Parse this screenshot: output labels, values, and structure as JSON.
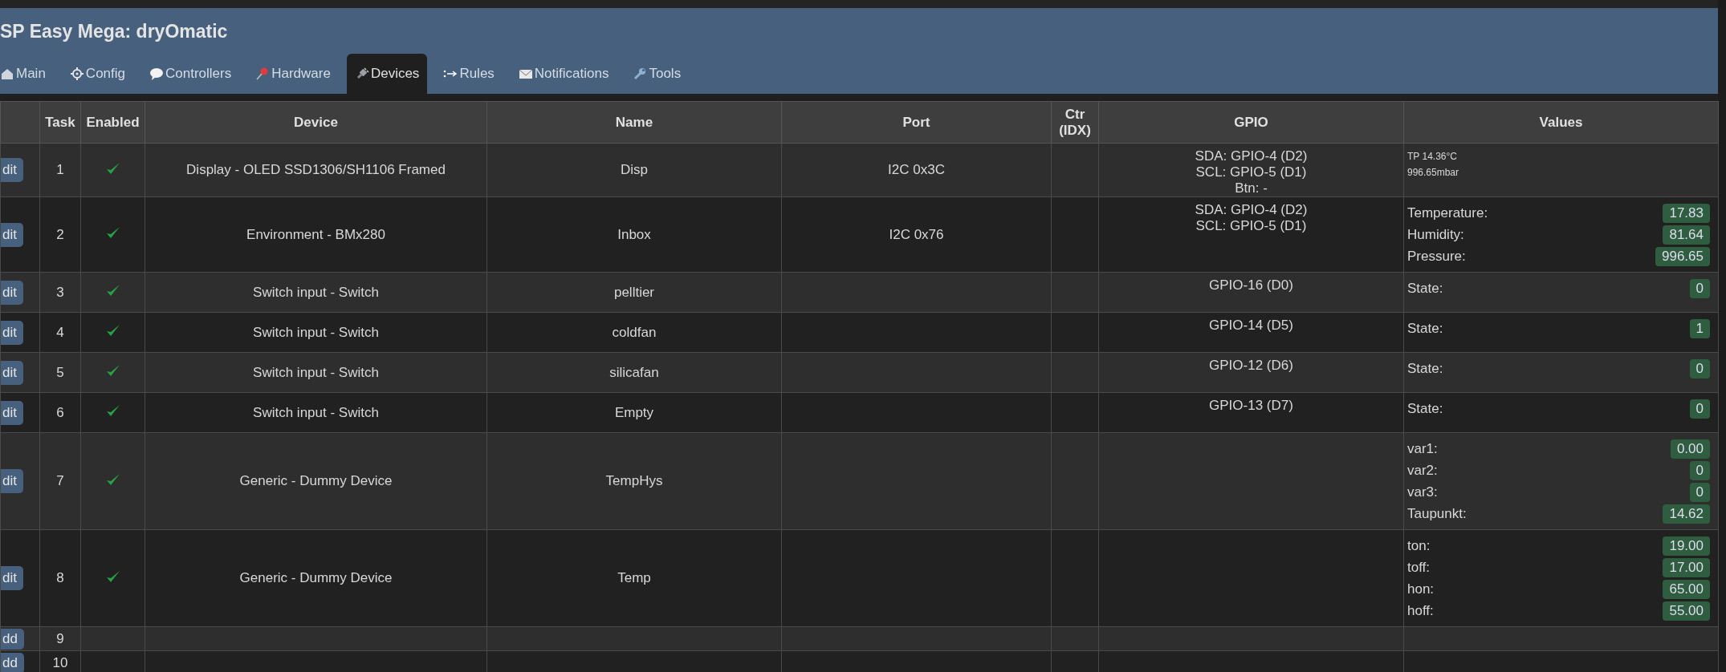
{
  "header": {
    "title": "SP Easy Mega: dryOmatic"
  },
  "tabs": [
    {
      "label": "Main",
      "selected": false
    },
    {
      "label": "Config",
      "selected": false
    },
    {
      "label": "Controllers",
      "selected": false
    },
    {
      "label": "Hardware",
      "selected": false
    },
    {
      "label": "Devices",
      "selected": true
    },
    {
      "label": "Rules",
      "selected": false
    },
    {
      "label": "Notifications",
      "selected": false
    },
    {
      "label": "Tools",
      "selected": false
    }
  ],
  "table": {
    "columns": [
      "",
      "Task",
      "Enabled",
      "Device",
      "Name",
      "Port",
      "Ctr (IDX)",
      "GPIO",
      "Values"
    ],
    "rows": [
      {
        "kind": "edit",
        "action": "dit",
        "task": "1",
        "enabled": true,
        "device": "Display - OLED SSD1306/SH1106 Framed",
        "name": "Disp",
        "port": "I2C 0x3C",
        "gpio": [
          "SDA: GPIO-4 (D2)",
          "SCL: GPIO-5 (D1)",
          "Btn: -"
        ],
        "values_text": [
          "TP 14.36°C",
          "996.65mbar"
        ]
      },
      {
        "kind": "edit",
        "action": "dit",
        "task": "2",
        "enabled": true,
        "device": "Environment - BMx280",
        "name": "Inbox",
        "port": "I2C 0x76",
        "gpio": [
          "SDA: GPIO-4 (D2)",
          "SCL: GPIO-5 (D1)"
        ],
        "values": [
          {
            "label": "Temperature:",
            "value": "17.83"
          },
          {
            "label": "Humidity:",
            "value": "81.64"
          },
          {
            "label": "Pressure:",
            "value": "996.65"
          }
        ]
      },
      {
        "kind": "edit",
        "action": "dit",
        "task": "3",
        "enabled": true,
        "device": "Switch input - Switch",
        "name": "pelltier",
        "gpio": [
          "GPIO-16 (D0)"
        ],
        "values": [
          {
            "label": "State:",
            "value": "0"
          }
        ]
      },
      {
        "kind": "edit",
        "action": "dit",
        "task": "4",
        "enabled": true,
        "device": "Switch input - Switch",
        "name": "coldfan",
        "gpio": [
          "GPIO-14 (D5)"
        ],
        "values": [
          {
            "label": "State:",
            "value": "1"
          }
        ]
      },
      {
        "kind": "edit",
        "action": "dit",
        "task": "5",
        "enabled": true,
        "device": "Switch input - Switch",
        "name": "silicafan",
        "gpio": [
          "GPIO-12 (D6)"
        ],
        "values": [
          {
            "label": "State:",
            "value": "0"
          }
        ]
      },
      {
        "kind": "edit",
        "action": "dit",
        "task": "6",
        "enabled": true,
        "device": "Switch input - Switch",
        "name": "Empty",
        "gpio": [
          "GPIO-13 (D7)"
        ],
        "values": [
          {
            "label": "State:",
            "value": "0"
          }
        ]
      },
      {
        "kind": "edit",
        "action": "dit",
        "task": "7",
        "enabled": true,
        "device": "Generic - Dummy Device",
        "name": "TempHys",
        "values": [
          {
            "label": "var1:",
            "value": "0.00"
          },
          {
            "label": "var2:",
            "value": "0"
          },
          {
            "label": "var3:",
            "value": "0"
          },
          {
            "label": "Taupunkt:",
            "value": "14.62"
          }
        ]
      },
      {
        "kind": "edit",
        "action": "dit",
        "task": "8",
        "enabled": true,
        "device": "Generic - Dummy Device",
        "name": "Temp",
        "values": [
          {
            "label": "ton:",
            "value": "19.00"
          },
          {
            "label": "toff:",
            "value": "17.00"
          },
          {
            "label": "hon:",
            "value": "65.00"
          },
          {
            "label": "hoff:",
            "value": "55.00"
          }
        ]
      },
      {
        "kind": "add",
        "action": "dd",
        "task": "9",
        "enabled": false
      },
      {
        "kind": "add",
        "action": "dd",
        "task": "10",
        "enabled": false
      }
    ]
  }
}
